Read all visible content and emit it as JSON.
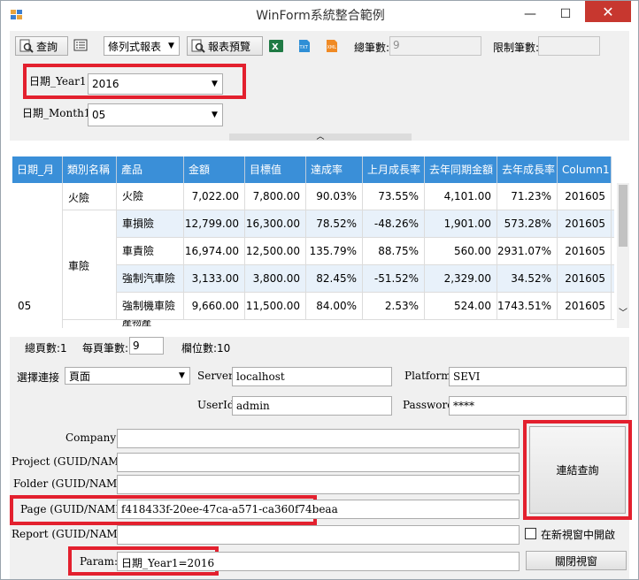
{
  "window": {
    "title": "WinForm系統整合範例"
  },
  "toolbar": {
    "query_label": "查詢",
    "report_type": "條列式報表",
    "preview_label": "報表預覽",
    "total_label": "總筆數:",
    "total_value": "9",
    "limit_label": "限制筆數:",
    "limit_value": "",
    "icons": [
      "search-icon",
      "list-icon",
      "excel-icon",
      "txt-icon",
      "xml-icon"
    ]
  },
  "params": {
    "year_label": "日期_Year1",
    "year_value": "2016",
    "month_label": "日期_Month1",
    "month_value": "05"
  },
  "grid": {
    "columns": [
      "日期_月",
      "類別名稱",
      "產品",
      "金額",
      "目標值",
      "達成率",
      "上月成長率",
      "去年同期金額",
      "去年成長率",
      "Column1"
    ],
    "group_month": "05",
    "category_1": "火險",
    "category_2": "車險",
    "partial_row_text": "產物產",
    "rows": [
      [
        "火險",
        "7,022.00",
        "7,800.00",
        "90.03%",
        "73.55%",
        "4,101.00",
        "71.23%",
        "201605"
      ],
      [
        "車損險",
        "12,799.00",
        "16,300.00",
        "78.52%",
        "-48.26%",
        "1,901.00",
        "573.28%",
        "201605"
      ],
      [
        "車責險",
        "16,974.00",
        "12,500.00",
        "135.79%",
        "88.75%",
        "560.00",
        "2931.07%",
        "201605"
      ],
      [
        "強制汽車險",
        "3,133.00",
        "3,800.00",
        "82.45%",
        "-51.52%",
        "2,329.00",
        "34.52%",
        "201605"
      ],
      [
        "強制機車險",
        "9,660.00",
        "11,500.00",
        "84.00%",
        "2.53%",
        "524.00",
        "1743.51%",
        "201605"
      ]
    ]
  },
  "grid_footer": {
    "total_pages_label": "總頁數:1",
    "per_page_label": "每頁筆數:",
    "per_page_value": "9",
    "column_count_label": "欄位數:10"
  },
  "connection": {
    "select_label": "選擇連接",
    "select_value": "頁面",
    "server_label": "Server",
    "server_value": "localhost",
    "platform_label": "Platform",
    "platform_value": "SEVI",
    "userid_label": "UserId",
    "userid_value": "admin",
    "password_label": "Password",
    "password_value": "****",
    "company_label": "Company:",
    "company_value": "",
    "project_label": "Project (GUID/NAME):",
    "project_value": "",
    "folder_label": "Folder (GUID/NAME):",
    "folder_value": "",
    "page_label": "Page (GUID/NAME):",
    "page_value": "f418433f-20ee-47ca-a571-ca360f74beaa",
    "report_label": "Report (GUID/NAME):",
    "report_value": "",
    "param_label": "Param:",
    "param_value": "日期_Year1=2016",
    "connect_query_label": "連結查詢",
    "new_window_label": "在新視窗中開啟",
    "close_window_label": "關閉視窗"
  },
  "colors": {
    "header_blue": "#3a8fd8",
    "highlight_red": "#e3202e",
    "alt_row": "#e8f1fa"
  }
}
